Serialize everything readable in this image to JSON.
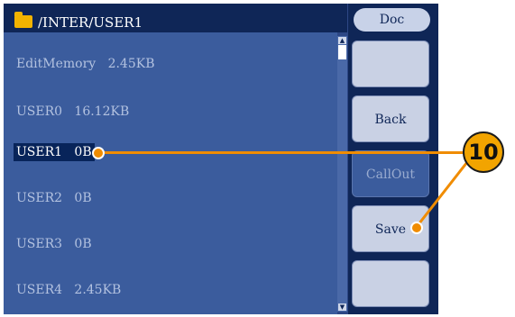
{
  "titlebar": {
    "path": "/INTER/USER1",
    "folder_icon": "folder-icon"
  },
  "files": [
    {
      "name": "EditMemory",
      "size": "2.45KB",
      "selected": false
    },
    {
      "name": "USER0",
      "size": "16.12KB",
      "selected": false
    },
    {
      "name": "USER1",
      "size": "0B",
      "selected": true
    },
    {
      "name": "USER2",
      "size": "0B",
      "selected": false
    },
    {
      "name": "USER3",
      "size": "0B",
      "selected": false
    },
    {
      "name": "USER4",
      "size": "2.45KB",
      "selected": false
    }
  ],
  "sidebar": {
    "doc_label": "Doc",
    "buttons": [
      {
        "label": "",
        "enabled": true
      },
      {
        "label": "Back",
        "enabled": true
      },
      {
        "label": "CallOut",
        "enabled": false
      },
      {
        "label": "Save",
        "enabled": true
      },
      {
        "label": "",
        "enabled": true
      }
    ]
  },
  "annotation": {
    "number": "10",
    "color": "#f08c00"
  },
  "colors": {
    "screen_bg": "#3b5c9d",
    "titlebar_bg": "#0f2657",
    "selected_bg": "#08245a"
  }
}
